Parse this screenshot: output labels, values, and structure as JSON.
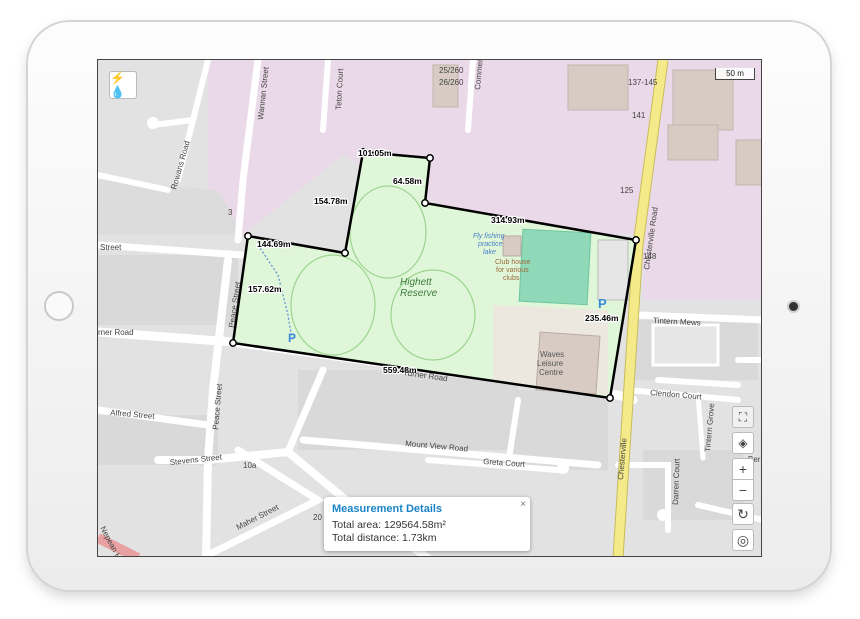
{
  "labels": {
    "measurements": [
      "101.05m",
      "64.58m",
      "154.78m",
      "314.93m",
      "144.69m",
      "157.62m",
      "235.46m",
      "559.48m"
    ],
    "streets": [
      "Wannan Street",
      "Teton Court",
      "Rowans Road",
      "Commer",
      "Street",
      "rner Road",
      "Peace Street",
      "Turner Road",
      "Alfred Street",
      "Stevens Street",
      "Mount View Road",
      "Greta Court",
      "Maher Street",
      "Tintern Mews",
      "Clendon Court",
      "Tintern Grove",
      "Darren Court",
      "Chesterville Road",
      "Chesterville",
      "Nepean Highw",
      "Ber"
    ],
    "places": [
      "Highett",
      "Reserve",
      "Waves",
      "Leisure",
      "Centre",
      "Fly fishing",
      "practice",
      "lake",
      "Club house",
      "for various",
      "clubs"
    ],
    "numbers": [
      "25/260",
      "26/260",
      "137-145",
      "141",
      "125",
      "148",
      "3",
      "10a",
      "20"
    ],
    "parking": "P",
    "scale": "50 m",
    "app_logo": "⚡💧"
  },
  "popup": {
    "title": "Measurement Details",
    "area_label": "Total area:",
    "area_value": "129564.58m²",
    "distance_label": "Total distance:",
    "distance_value": "1.73km",
    "close": "×"
  },
  "controls": {
    "zoom_in": "+",
    "zoom_out": "−",
    "rotate": "↻",
    "locate": "◎",
    "measure": "⛶",
    "layers": "◈"
  },
  "colors": {
    "measured_area": "#dff7d8",
    "boundary": "#000000",
    "residential": "#ead9e8",
    "sports_pitch": "#8fd9b8",
    "main_road": "#f4ea8a",
    "accent": "#1a84c8"
  }
}
